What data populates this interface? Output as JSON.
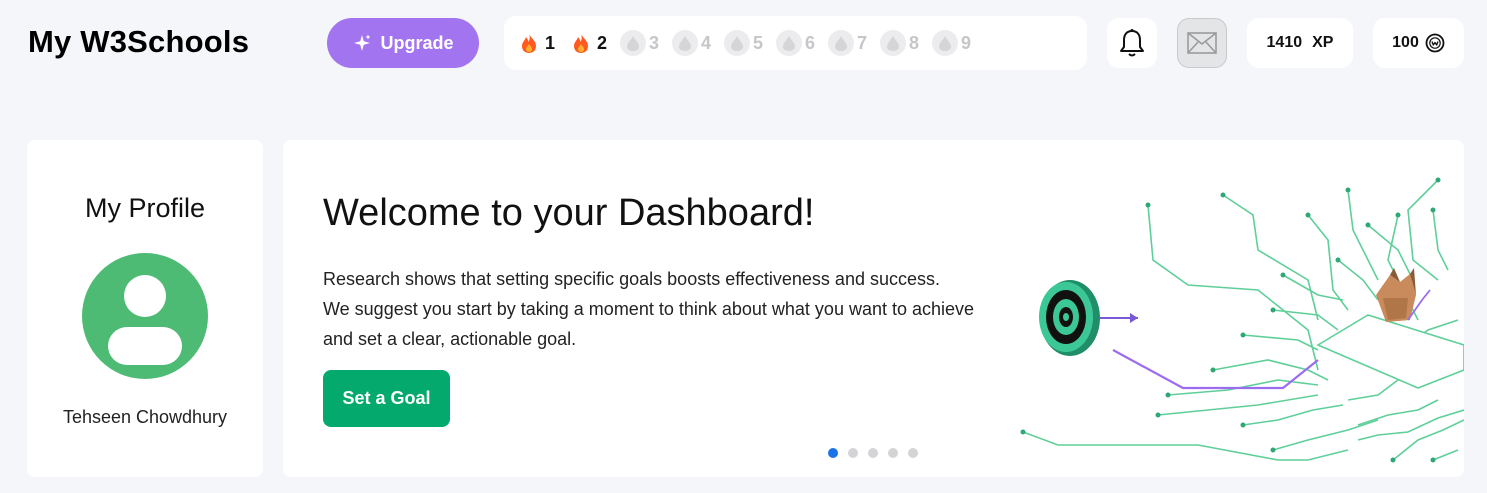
{
  "header": {
    "brand": "My W3Schools",
    "upgrade_label": "Upgrade",
    "streak_days": [
      {
        "num": "1",
        "active": true
      },
      {
        "num": "2",
        "active": true
      },
      {
        "num": "3",
        "active": false
      },
      {
        "num": "4",
        "active": false
      },
      {
        "num": "5",
        "active": false
      },
      {
        "num": "6",
        "active": false
      },
      {
        "num": "7",
        "active": false
      },
      {
        "num": "8",
        "active": false
      },
      {
        "num": "9",
        "active": false
      }
    ],
    "xp_value": "1410",
    "xp_unit": "XP",
    "coins_value": "100"
  },
  "profile": {
    "title": "My Profile",
    "name": "Tehseen Chowdhury"
  },
  "dashboard": {
    "title": "Welcome to your Dashboard!",
    "lines": [
      "Research shows that setting specific goals boosts effectiveness and success.",
      "We suggest you start by taking a moment to think about what you want to achieve",
      "and set a clear, actionable goal."
    ],
    "cta_label": "Set a Goal",
    "carousel_total": 5,
    "carousel_active": 0
  },
  "colors": {
    "accent_purple": "#a374f0",
    "accent_green": "#04aa6d",
    "avatar_green": "#4dbb74",
    "flame": "#ff5a1f",
    "circuit_green": "#5fcf9a"
  }
}
